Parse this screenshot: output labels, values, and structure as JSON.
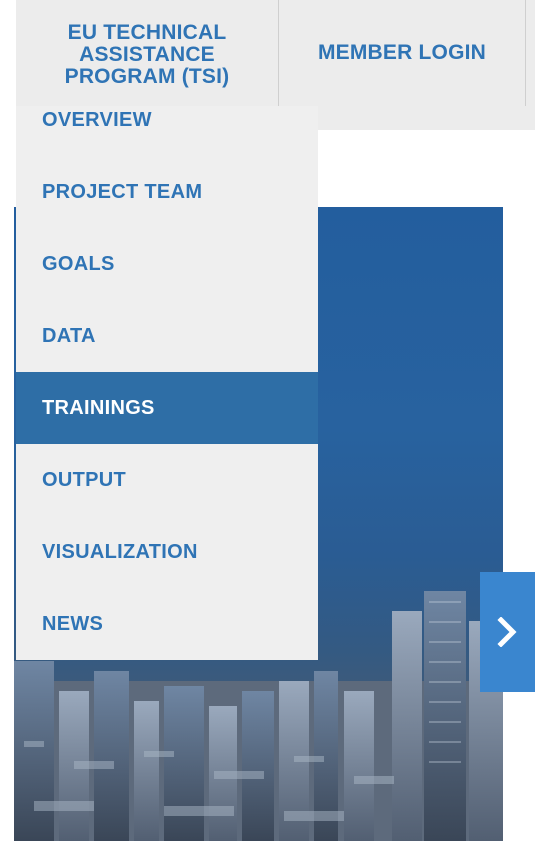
{
  "topnav": {
    "items": [
      {
        "label_lines": [
          "EU TECHNICAL",
          "ASSISTANCE",
          "PROGRAM (TSI)"
        ]
      },
      {
        "label": "MEMBER LOGIN"
      }
    ]
  },
  "dropdown": {
    "items": [
      {
        "label": "OVERVIEW"
      },
      {
        "label": "PROJECT TEAM"
      },
      {
        "label": "GOALS"
      },
      {
        "label": "DATA"
      },
      {
        "label": "TRAININGS",
        "active": true
      },
      {
        "label": "OUTPUT"
      },
      {
        "label": "VISUALIZATION"
      },
      {
        "label": "NEWS"
      }
    ]
  },
  "slider": {
    "next_icon": "chevron-right-icon"
  },
  "colors": {
    "accent": "#2f74b5",
    "active_bg": "#2e6ea6",
    "menu_bg": "#efefef",
    "nav_bg": "#ececec",
    "arrow_bg": "#3a86cf"
  }
}
